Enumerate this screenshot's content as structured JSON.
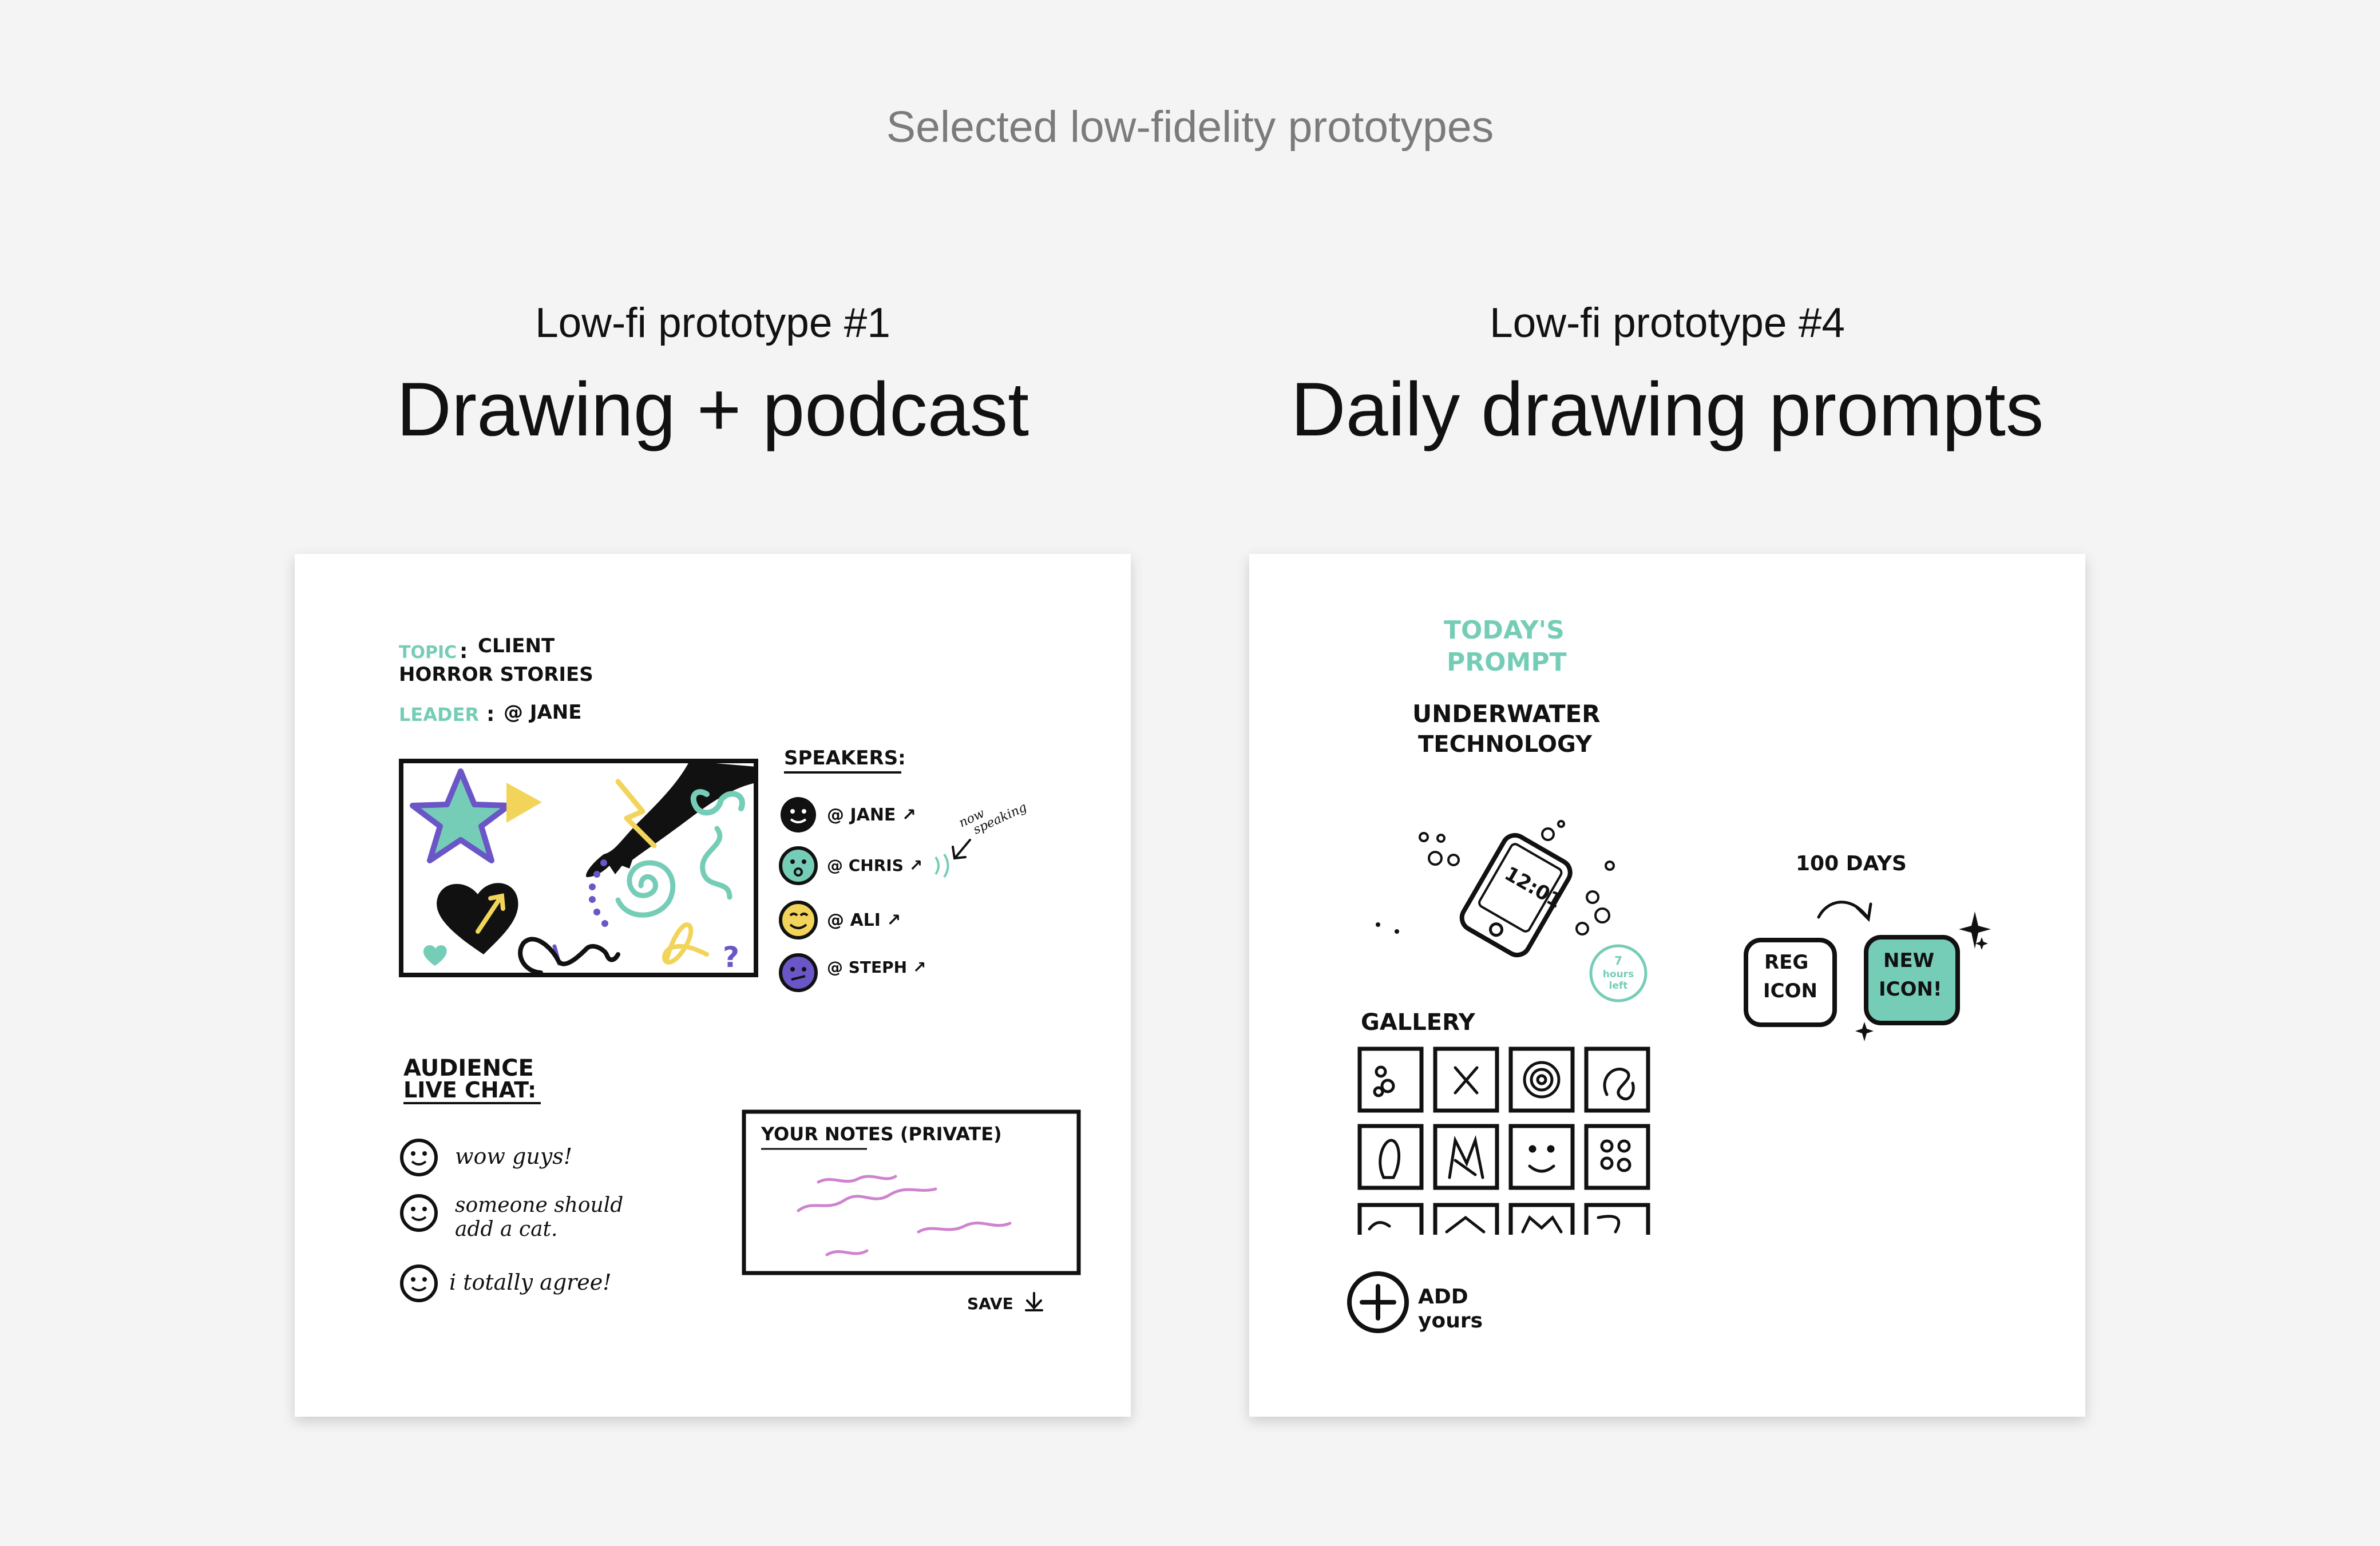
{
  "page": {
    "title": "Selected low-fidelity prototypes"
  },
  "prototypes": [
    {
      "subtitle": "Low-fi prototype #1",
      "title": "Drawing + podcast",
      "sketch": {
        "topic_label": "TOPIC",
        "topic_value_1": "CLIENT",
        "topic_value_2": "HORROR STORIES",
        "leader_label": "LEADER",
        "leader_value": "@ JANE",
        "speakers_heading": "SPEAKERS:",
        "speakers": [
          "@ JANE ↗",
          "@ CHRIS ↗",
          "@ ALI ↗",
          "@ STEPH ↗"
        ],
        "now_speaking_1": "now",
        "now_speaking_2": "speaking",
        "chat_heading_1": "AUDIENCE",
        "chat_heading_2": "LIVE CHAT:",
        "chat_messages": [
          "wow guys!",
          "someone should",
          "add a cat.",
          "i totally agree!"
        ],
        "notes_heading": "YOUR NOTES (PRIVATE)",
        "save_label": "SAVE"
      }
    },
    {
      "subtitle": "Low-fi prototype #4",
      "title": "Daily drawing prompts",
      "sketch": {
        "prompt_heading_1": "TODAY'S",
        "prompt_heading_2": "PROMPT",
        "prompt_text_1": "UNDERWATER",
        "prompt_text_2": "TECHNOLOGY",
        "phone_time": "12:01",
        "hours_left_1": "7",
        "hours_left_2": "hours",
        "hours_left_3": "left",
        "days_label": "100 DAYS",
        "reg_icon_1": "REG",
        "reg_icon_2": "ICON",
        "new_icon_1": "NEW",
        "new_icon_2": "ICON!",
        "gallery_heading": "GALLERY",
        "add_yours_1": "ADD",
        "add_yours_2": "yours"
      }
    }
  ],
  "colors": {
    "background": "#f4f4f4",
    "card": "#ffffff",
    "teal": "#76cdb7",
    "purple": "#6a56c6",
    "yellow": "#f2d45a",
    "pink": "#cf83cf",
    "ink": "#111111",
    "caption_gray": "#7b7b7b"
  }
}
